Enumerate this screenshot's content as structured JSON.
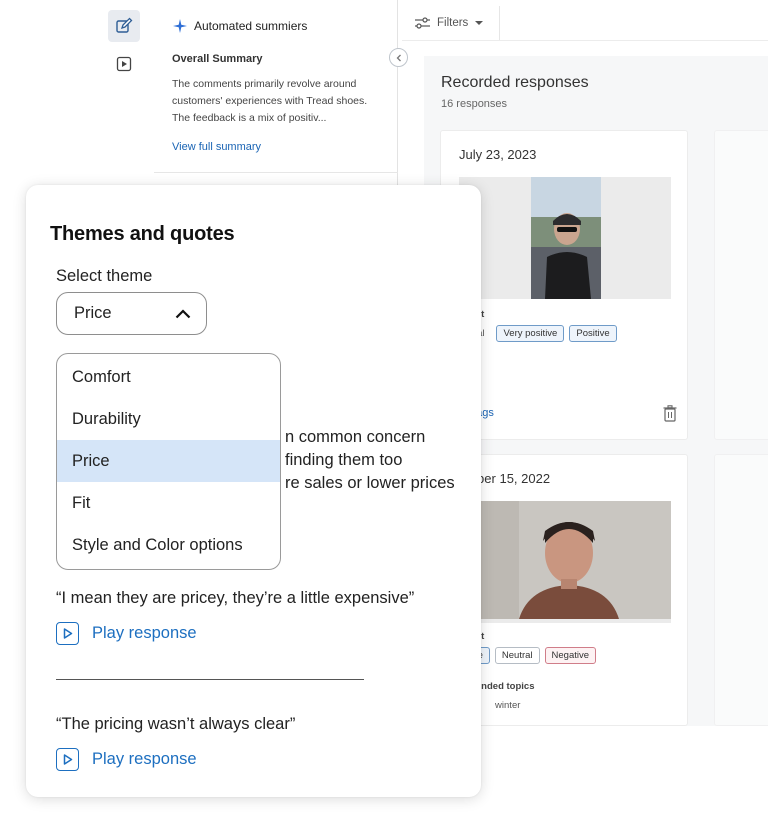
{
  "summary": {
    "header": "Automated summiers",
    "subtitle": "Overall Summary",
    "text": "The comments primarily revolve around customers' experiences with Tread shoes. The feedback is a mix of positiv...",
    "link": "View full summary"
  },
  "filters": {
    "label": "Filters"
  },
  "responses": {
    "title": "Recorded responses",
    "count": "16 responses",
    "cards": [
      {
        "date": "July 23, 2023",
        "section": "iment",
        "tags": [
          "utral",
          "Very positive",
          "Positive"
        ],
        "link": "all tags"
      },
      {
        "date": "ember 15, 2022",
        "section": "iment",
        "tags": [
          "itive",
          "Neutral",
          "Negative"
        ],
        "topics_label": "mmended topics",
        "topics": [
          "es",
          "winter"
        ]
      }
    ]
  },
  "themes": {
    "title": "Themes and quotes",
    "select_label": "Select theme",
    "selected": "Price",
    "options": [
      "Comfort",
      "Durability",
      "Price",
      "Fit",
      "Style and Color options"
    ],
    "body_lines": [
      "n common concern",
      "finding them too",
      "re sales or lower prices"
    ],
    "quotes": [
      {
        "text": "“I mean they are pricey, they’re a little expensive”",
        "action": "Play response"
      },
      {
        "text": "“The pricing wasn’t always clear”",
        "action": "Play response"
      }
    ]
  },
  "colors": {
    "accent": "#1d6fc0",
    "selected_option_bg": "#d5e5f8",
    "link": "#1a64b4",
    "negative_tag": "#d07d89"
  },
  "icons": [
    "edit-icon",
    "video-icon",
    "sparkle-icon",
    "collapse-chevron-icon",
    "filter-icon",
    "caret-down-icon",
    "trash-icon",
    "chevron-up-icon",
    "play-icon"
  ]
}
